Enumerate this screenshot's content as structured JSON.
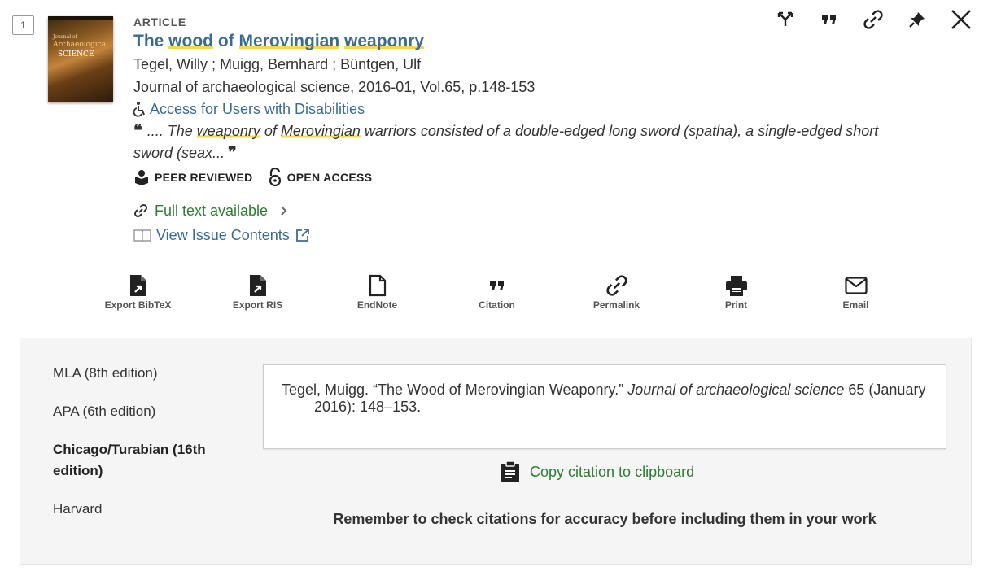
{
  "record_number": "1",
  "cover": {
    "line1": "Journal of",
    "line2": "Archaeological",
    "line3": "SCIENCE"
  },
  "record": {
    "type": "ARTICLE",
    "title_parts": [
      "The ",
      "wood",
      " of ",
      "Merovingian",
      " ",
      "weaponry"
    ],
    "authors": "Tegel, Willy ; Muigg, Bernhard ; Büntgen, Ulf",
    "source": "Journal of archaeological science, 2016-01, Vol.65, p.148-153",
    "accessibility_link": "Access for Users with Disabilities",
    "snippet_parts": [
      ".... The ",
      "weaponry",
      " of ",
      "Merovingian",
      " warriors consisted of a double-edged long sword (spatha), a single-edged short sword (seax..."
    ],
    "badges": {
      "peer_reviewed": "PEER REVIEWED",
      "open_access": "OPEN ACCESS"
    },
    "full_text": "Full text available",
    "issue_contents": "View Issue Contents"
  },
  "top_actions": [
    "branch-icon",
    "quote-icon",
    "link-icon",
    "pin-icon",
    "close-icon"
  ],
  "toolbar": {
    "export_bibtex": "Export BibTeX",
    "export_ris": "Export RIS",
    "endnote": "EndNote",
    "citation": "Citation",
    "permalink": "Permalink",
    "print": "Print",
    "email": "Email"
  },
  "citation_panel": {
    "styles": [
      "MLA (8th edition)",
      "APA (6th edition)",
      "Chicago/Turabian (16th edition)",
      "Harvard"
    ],
    "active_style_index": 2,
    "citation_text_before": "Tegel, Muigg. “The Wood of Merovingian Weaponry.” ",
    "citation_journal": "Journal of archaeological science",
    "citation_text_after": " 65 (January 2016): 148–153.",
    "copy_label": "Copy citation to clipboard",
    "reminder": "Remember to check citations for accuracy before including them in your work"
  },
  "colors": {
    "link": "#3b6b94",
    "green": "#2e7d32",
    "highlight": "#f6d94a"
  }
}
